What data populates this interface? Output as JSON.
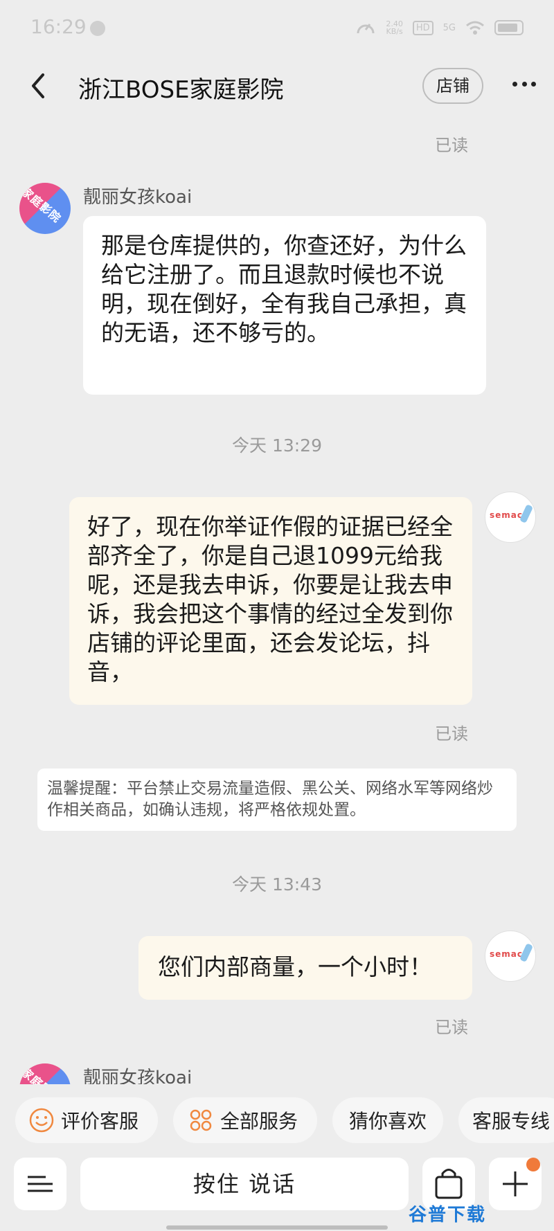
{
  "status_bar": {
    "time": "16:29",
    "speed": "2.40\nKB/s",
    "hd": "HD",
    "signal": "5G"
  },
  "header": {
    "title": "浙江BOSE家庭影院",
    "store_button": "店铺"
  },
  "read_label": "已读",
  "messages": {
    "customer_nick": "靓丽女孩koai",
    "customer_avatar_text": "家庭影院",
    "shop_avatar_text": "semaco",
    "msg1": "那是仓库提供的，你查还好，为什么给它注册了。而且退款时候也不说明，现在倒好，全有我自己承担，真的无语，还不够亏的。",
    "time1": "今天  13:29",
    "msg2": "好了，现在你举证作假的证据已经全部齐全了，你是自己退1099元给我呢，还是我去申诉，你要是让我去申诉，我会把这个事情的经过全发到你店铺的评论里面，还会发论坛，抖音，",
    "notice": "温馨提醒：平台禁止交易流量造假、黑公关、网络水军等网络炒作相关商品，如确认违规，将严格依规处置。",
    "time2": "今天  13:43",
    "msg3": "您们内部商量，一个小时！"
  },
  "quick_chips": [
    {
      "label": "评价客服",
      "icon": "smile-icon"
    },
    {
      "label": "全部服务",
      "icon": "grid-icon"
    },
    {
      "label": "猜你喜欢",
      "icon": ""
    },
    {
      "label": "客服专线",
      "icon": ""
    }
  ],
  "input_bar": {
    "hold_to_talk": "按住 说话"
  },
  "watermark": "谷普下载",
  "colors": {
    "background": "#ededed",
    "incoming_bubble": "#ffffff",
    "outgoing_bubble": "#fdf8ec",
    "chip_icon": "#f0883f",
    "badge": "#f07a3a"
  }
}
